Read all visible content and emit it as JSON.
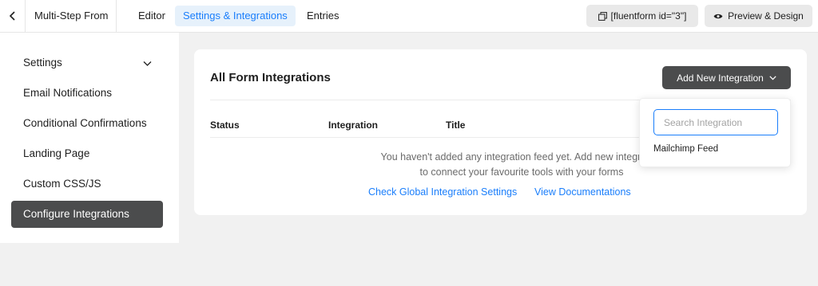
{
  "topbar": {
    "form_name": "Multi-Step From",
    "tabs": [
      {
        "label": "Editor"
      },
      {
        "label": "Settings & Integrations"
      },
      {
        "label": "Entries"
      }
    ],
    "shortcode": "[fluentform id=\"3\"]",
    "preview_label": "Preview & Design"
  },
  "sidebar": {
    "items": [
      {
        "label": "Settings"
      },
      {
        "label": "Email Notifications"
      },
      {
        "label": "Conditional Confirmations"
      },
      {
        "label": "Landing Page"
      },
      {
        "label": "Custom CSS/JS"
      },
      {
        "label": "Configure Integrations"
      }
    ]
  },
  "main": {
    "title": "All Form Integrations",
    "add_button": "Add New Integration",
    "columns": [
      "Status",
      "Integration",
      "Title"
    ],
    "empty_line1": "You haven't added any integration feed yet. Add new integration",
    "empty_line2": "to connect your favourite tools with your forms",
    "link_global": "Check Global Integration Settings",
    "link_docs": "View Documentations"
  },
  "dropdown": {
    "search_placeholder": "Search Integration",
    "items": [
      {
        "label": "Mailchimp Feed"
      }
    ]
  },
  "colors": {
    "accent": "#1a7efb",
    "dark_button": "#4b4c4d",
    "page_bg": "#f1f1f1"
  },
  "icons": {
    "back": "chevron-left-icon",
    "shortcode": "copy-icon",
    "preview": "eye-icon",
    "settings_toggle": "chevron-down-icon",
    "add_button": "chevron-down-icon"
  }
}
